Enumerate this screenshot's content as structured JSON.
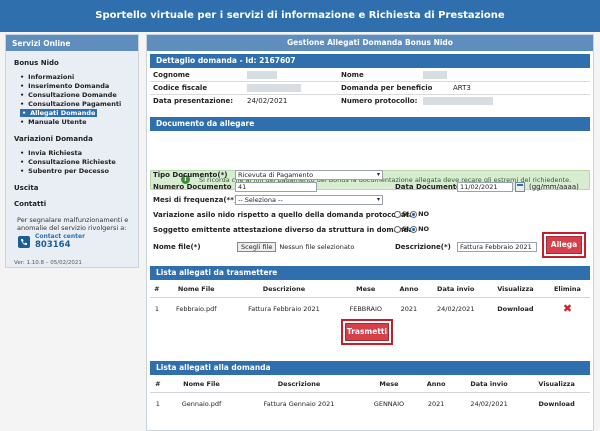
{
  "header": {
    "title": "Sportello virtuale per i servizi di informazione e Richiesta di Prestazione"
  },
  "sidebar": {
    "title": "Servizi Online",
    "group1": "Bonus Nido",
    "items1": [
      "Informazioni",
      "Inserimento Domanda",
      "Consultazione Domande",
      "Consultazione Pagamenti",
      "Allegati Domande",
      "Manuale Utente"
    ],
    "group2": "Variazioni Domanda",
    "items2": [
      "Invia Richiesta",
      "Consultazione Richieste",
      "Subentro per Decesso"
    ],
    "exit": "Uscita",
    "contacts": "Contatti",
    "note": "Per segnalare malfunzionamenti e anomalie del servizio rivolgersi a:",
    "cc_label": "Contact center",
    "cc_number": "803164",
    "version": "Ver: 1.10.8 – 05/02/2021"
  },
  "main": {
    "title": "Gestione Allegati Domanda Bonus Nido",
    "detail_title": "Dettaglio domanda - Id: 2167607",
    "detail": {
      "cognome": "Cognome",
      "nome": "Nome",
      "cf": "Codice fiscale",
      "dom_ben": "Domanda per beneficio",
      "dom_ben_val": "ART3",
      "data_pres": "Data presentazione:",
      "data_pres_val": "24/02/2021",
      "num_prot": "Numero protocollo:"
    },
    "doc_title": "Documento da allegare",
    "info": "Si ricorda che ai fini del pagamento del Bonus la documentazione allegata deve recare gli estremi del richiedente.",
    "form": {
      "tipo_label": "Tipo Documento(*)",
      "tipo_val": "Ricevuta di Pagamento",
      "num_label": "Numero Documento",
      "num_val": "41",
      "data_label": "Data Documento",
      "data_val": "11/02/2021",
      "data_fmt": "(gg/mm/aaaa)",
      "mesi_label": "Mesi di frequenza(**)",
      "mesi_val": "-- Seleziona --",
      "var_label": "Variazione asilo nido rispetto a quello della domanda protocollata",
      "sogg_label": "Soggetto emittente attestazione diverso da struttura in domanda",
      "si": "SI",
      "no": "NO",
      "file_label": "Nome file(*)",
      "file_btn": "Scegli file",
      "file_val": "Nessun file selezionato",
      "desc_label": "Descrizione(*)",
      "desc_val": "Fattura Febbraio 2021",
      "allega": "Allega"
    },
    "list1_title": "Lista allegati da trasmettere",
    "list1_headers": [
      "#",
      "Nome File",
      "Descrizione",
      "Mese",
      "Anno",
      "Data invio",
      "Visualizza",
      "Elimina"
    ],
    "list1_rows": [
      [
        "1",
        "Febbraio.pdf",
        "Fattura Febbraio 2021",
        "FEBBRAIO",
        "2021",
        "24/02/2021",
        "Download"
      ]
    ],
    "trasmetti": "Trasmetti",
    "list2_title": "Lista allegati alla domanda",
    "list2_headers": [
      "#",
      "Nome File",
      "Descrizione",
      "Mese",
      "Anno",
      "Data invio",
      "Visualizza"
    ],
    "list2_rows": [
      [
        "1",
        "Gennaio.pdf",
        "Fattura Gennaio 2021",
        "GENNAIO",
        "2021",
        "24/02/2021",
        "Download"
      ]
    ]
  }
}
